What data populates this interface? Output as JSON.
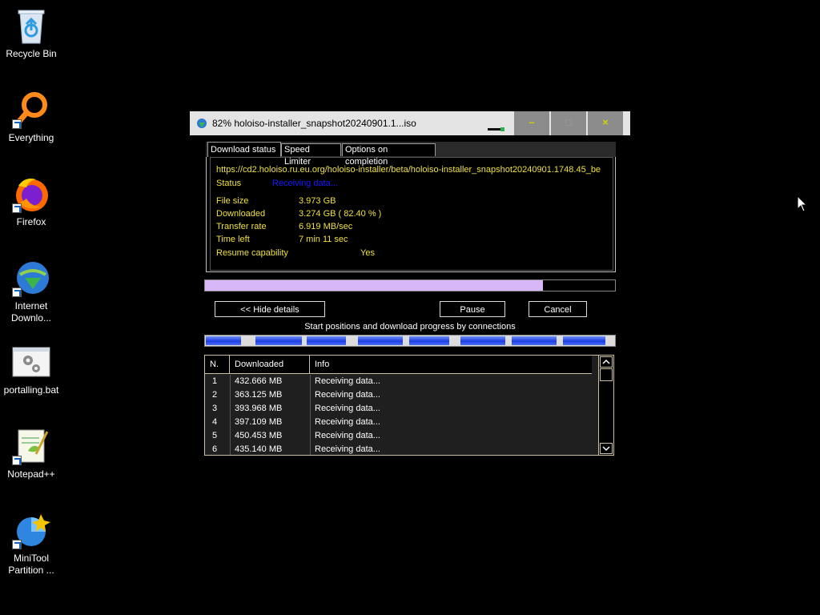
{
  "desktop": {
    "icons": [
      {
        "name": "recycle-bin",
        "label": "Recycle Bin"
      },
      {
        "name": "everything",
        "label": "Everything"
      },
      {
        "name": "firefox",
        "label": "Firefox"
      },
      {
        "name": "idm",
        "label_line1": "Internet",
        "label_line2": "Downlo..."
      },
      {
        "name": "portalling-bat",
        "label": "portalling.bat"
      },
      {
        "name": "notepadpp",
        "label": "Notepad++"
      },
      {
        "name": "minitool",
        "label_line1": "MiniTool",
        "label_line2": "Partition ..."
      }
    ]
  },
  "window": {
    "title": "82% holoiso-installer_snapshot20240901.1...iso",
    "buttons": {
      "minimize": "–",
      "maximize": "□",
      "close": "×"
    },
    "tabs": [
      "Download status",
      "Speed Limiter",
      "Options on completion"
    ],
    "url": "https://cd2.holoiso.ru.eu.org/holoiso-installer/beta/holoiso-installer_snapshot20240901.1748.45_be",
    "status_label": "Status",
    "status_value": "Receiving data...",
    "file_size_label": "File size",
    "file_size_value": "3.973  GB",
    "downloaded_label": "Downloaded",
    "downloaded_value": "3.274  GB  ( 82.40 % )",
    "transfer_rate_label": "Transfer rate",
    "transfer_rate_value": "6.919  MB/sec",
    "time_left_label": "Time left",
    "time_left_value": "7 min  11 sec",
    "resume_label": "Resume capability",
    "resume_value": "Yes",
    "progress_fraction": 0.824,
    "hide_details_label": "<< Hide details",
    "pause_label": "Pause",
    "cancel_label": "Cancel",
    "connections_caption": "Start positions and download progress by connections",
    "table": {
      "headers": [
        "N.",
        "Downloaded",
        "Info"
      ],
      "rows": [
        {
          "n": "1",
          "downloaded": "432.666  MB",
          "info": "Receiving data..."
        },
        {
          "n": "2",
          "downloaded": "363.125  MB",
          "info": "Receiving data..."
        },
        {
          "n": "3",
          "downloaded": "393.968  MB",
          "info": "Receiving data..."
        },
        {
          "n": "4",
          "downloaded": "397.109  MB",
          "info": "Receiving data..."
        },
        {
          "n": "5",
          "downloaded": "450.453  MB",
          "info": "Receiving data..."
        },
        {
          "n": "6",
          "downloaded": "435.140  MB",
          "info": "Receiving data..."
        }
      ]
    }
  },
  "colors": {
    "text_yellow": "#f0e040",
    "progress_fill": "#d7b7f7",
    "conn_blue": "#1e3fe5",
    "status_blue": "#1a1aff"
  }
}
